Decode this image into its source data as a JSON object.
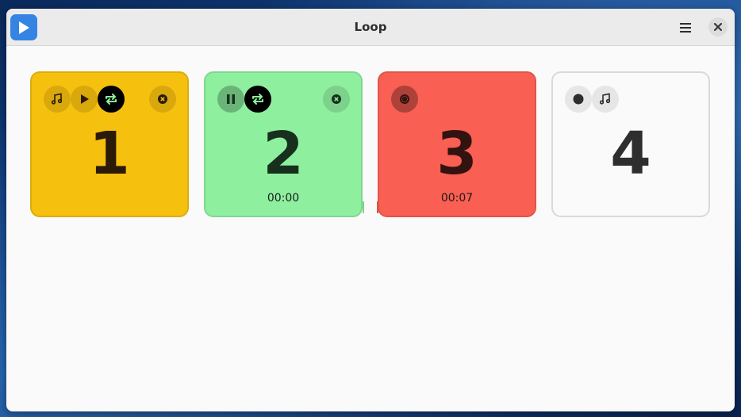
{
  "window": {
    "title": "Loop"
  },
  "titlebar": {
    "app_icon": "play-icon",
    "menu_icon": "hamburger-menu-icon",
    "close_icon": "close-icon"
  },
  "loops": [
    {
      "number": "1",
      "color": "#f6c00f",
      "controls": [
        "music-note-icon",
        "play-icon",
        "repeat-icon",
        "remove-icon"
      ],
      "state": "stopped"
    },
    {
      "number": "2",
      "color": "#8ef09f",
      "controls": [
        "pause-icon",
        "repeat-icon",
        "remove-icon"
      ],
      "time": "00:00",
      "state": "playing"
    },
    {
      "number": "3",
      "color": "#f95f52",
      "controls": [
        "recording-icon"
      ],
      "time": "00:07",
      "state": "recording"
    },
    {
      "number": "4",
      "color": "#fafafa",
      "controls": [
        "record-icon",
        "music-note-icon"
      ],
      "state": "empty"
    }
  ]
}
